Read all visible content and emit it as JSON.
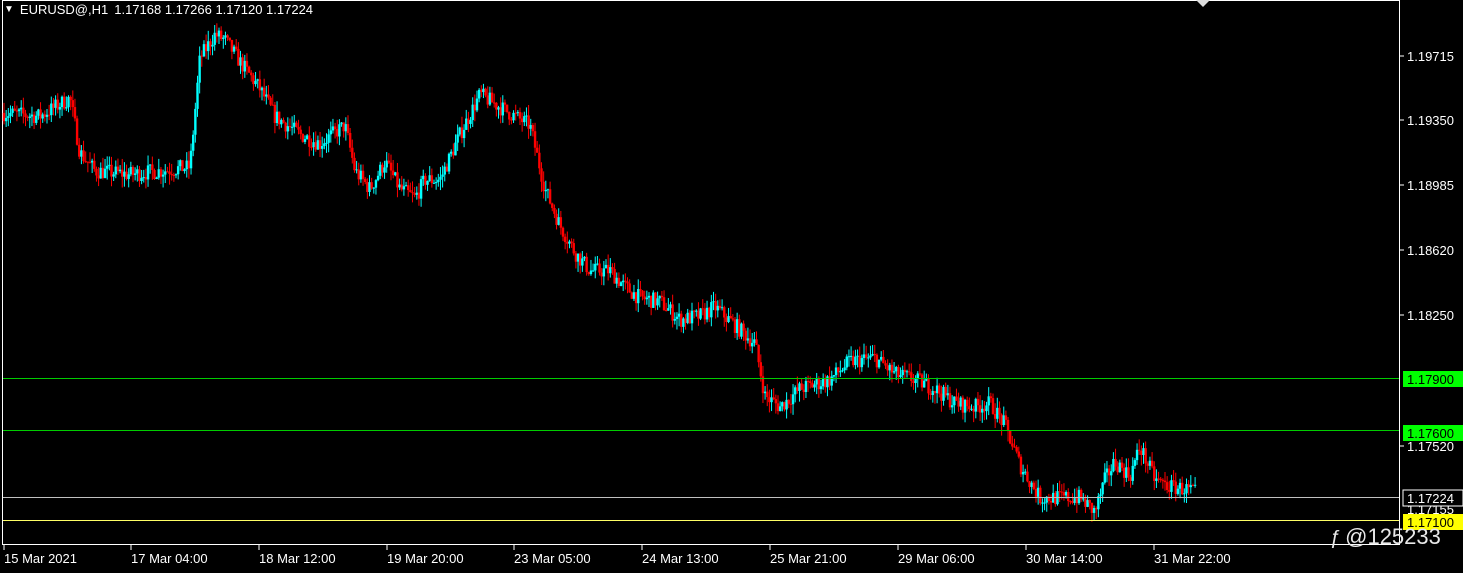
{
  "header": {
    "symbol_timeframe": "EURUSD@,H1",
    "ohlc": "1.17168 1.17266 1.17120 1.17224"
  },
  "colors": {
    "background": "#000000",
    "bull_candle": "#00ffff",
    "bear_candle": "#ff0000",
    "level_line": "#00cc00",
    "level_label_bg": "#00ff00",
    "bid_line": "#c0c0c0",
    "ask_label_bg": "#ffff00",
    "axis": "#ffffff"
  },
  "axis": {
    "price_ticks": [
      "1.19715",
      "1.19350",
      "1.18985",
      "1.18620",
      "1.18250",
      "1.17520"
    ],
    "time_ticks": [
      "15 Mar 2021",
      "17 Mar 04:00",
      "18 Mar 12:00",
      "19 Mar 20:00",
      "23 Mar 05:00",
      "24 Mar 13:00",
      "25 Mar 21:00",
      "29 Mar 06:00",
      "30 Mar 14:00",
      "31 Mar 22:00"
    ]
  },
  "levels": {
    "upper": "1.17900",
    "lower": "1.17600",
    "current_bid": "1.17224",
    "hidden_label": "1.17155",
    "yellow_level": "1.17100"
  },
  "watermark": {
    "icon": "weibo-like-icon",
    "text": "@125233"
  },
  "chart_data": {
    "type": "candlestick",
    "symbol": "EURUSD@",
    "timeframe": "H1",
    "y_range": [
      1.1694,
      1.1994
    ],
    "close_path": [
      [
        0,
        1.1932
      ],
      [
        40,
        1.193
      ],
      [
        70,
        1.194
      ],
      [
        80,
        1.191
      ],
      [
        95,
        1.19
      ],
      [
        130,
        1.1898
      ],
      [
        160,
        1.19
      ],
      [
        190,
        1.1902
      ],
      [
        200,
        1.1962
      ],
      [
        215,
        1.1975
      ],
      [
        225,
        1.1972
      ],
      [
        240,
        1.196
      ],
      [
        260,
        1.1945
      ],
      [
        275,
        1.193
      ],
      [
        300,
        1.192
      ],
      [
        320,
        1.1915
      ],
      [
        345,
        1.1925
      ],
      [
        355,
        1.19
      ],
      [
        370,
        1.189
      ],
      [
        385,
        1.1905
      ],
      [
        400,
        1.189
      ],
      [
        415,
        1.1885
      ],
      [
        425,
        1.1895
      ],
      [
        440,
        1.1895
      ],
      [
        460,
        1.192
      ],
      [
        480,
        1.1942
      ],
      [
        500,
        1.1935
      ],
      [
        530,
        1.1925
      ],
      [
        545,
        1.189
      ],
      [
        560,
        1.187
      ],
      [
        575,
        1.1855
      ],
      [
        590,
        1.1845
      ],
      [
        610,
        1.1845
      ],
      [
        625,
        1.1836
      ],
      [
        640,
        1.183
      ],
      [
        660,
        1.1828
      ],
      [
        680,
        1.1818
      ],
      [
        700,
        1.182
      ],
      [
        715,
        1.1825
      ],
      [
        735,
        1.1815
      ],
      [
        755,
        1.1805
      ],
      [
        765,
        1.1776
      ],
      [
        780,
        1.177
      ],
      [
        800,
        1.178
      ],
      [
        830,
        1.1785
      ],
      [
        850,
        1.1795
      ],
      [
        875,
        1.1797
      ],
      [
        895,
        1.1788
      ],
      [
        915,
        1.1785
      ],
      [
        935,
        1.178
      ],
      [
        955,
        1.1772
      ],
      [
        975,
        1.177
      ],
      [
        990,
        1.1772
      ],
      [
        1005,
        1.176
      ],
      [
        1020,
        1.1738
      ],
      [
        1040,
        1.172
      ],
      [
        1060,
        1.172
      ],
      [
        1080,
        1.172
      ],
      [
        1095,
        1.1712
      ],
      [
        1105,
        1.173
      ],
      [
        1115,
        1.174
      ],
      [
        1130,
        1.1732
      ],
      [
        1140,
        1.1748
      ],
      [
        1155,
        1.173
      ],
      [
        1170,
        1.1726
      ],
      [
        1185,
        1.1725
      ],
      [
        1197,
        1.17224
      ]
    ]
  }
}
